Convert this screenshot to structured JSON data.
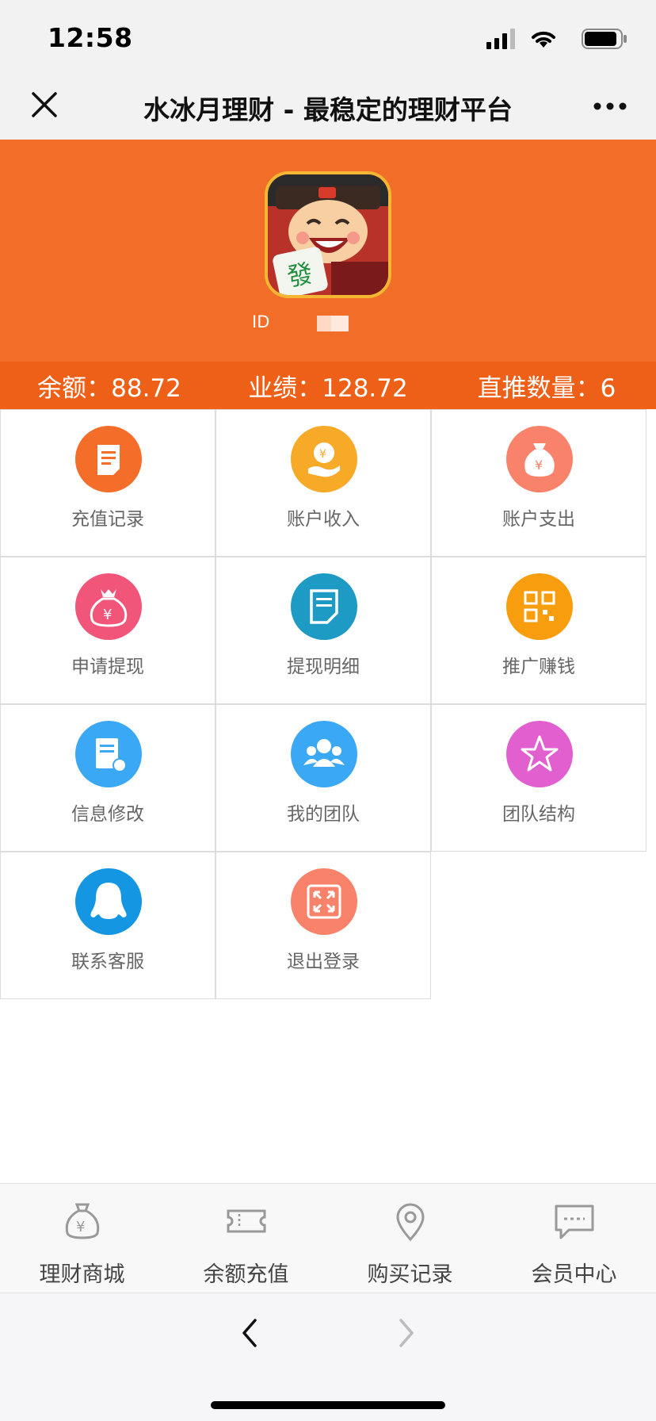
{
  "status_bar": {
    "time": "12:58"
  },
  "nav": {
    "title": "水冰月理财 - 最稳定的理财平台"
  },
  "profile": {
    "id_label": "ID"
  },
  "stats": {
    "balance": "余额：88.72",
    "performance": "业绩：128.72",
    "direct_referrals": "直推数量：6"
  },
  "menu": [
    {
      "label": "充值记录",
      "icon": "receipt-icon",
      "color": "#f46e2a"
    },
    {
      "label": "账户收入",
      "icon": "income-hand-icon",
      "color": "#f7a928"
    },
    {
      "label": "账户支出",
      "icon": "money-bag-icon",
      "color": "#f8836a"
    },
    {
      "label": "申请提现",
      "icon": "withdraw-bag-icon",
      "color": "#f2557a"
    },
    {
      "label": "提现明细",
      "icon": "document-icon",
      "color": "#1d9bc4"
    },
    {
      "label": "推广赚钱",
      "icon": "qr-code-icon",
      "color": "#f89d0e"
    },
    {
      "label": "信息修改",
      "icon": "edit-document-icon",
      "color": "#3ba8f5"
    },
    {
      "label": "我的团队",
      "icon": "team-icon",
      "color": "#3ba8f5"
    },
    {
      "label": "团队结构",
      "icon": "star-icon",
      "color": "#e25fcf"
    },
    {
      "label": "联系客服",
      "icon": "qq-penguin-icon",
      "color": "#1596e3"
    },
    {
      "label": "退出登录",
      "icon": "expand-icon",
      "color": "#f8836a"
    }
  ],
  "tabs": [
    {
      "label": "理财商城",
      "icon": "money-bag-outline-icon"
    },
    {
      "label": "余额充值",
      "icon": "ticket-icon"
    },
    {
      "label": "购买记录",
      "icon": "location-pin-icon"
    },
    {
      "label": "会员中心",
      "icon": "chat-bubble-icon"
    }
  ]
}
